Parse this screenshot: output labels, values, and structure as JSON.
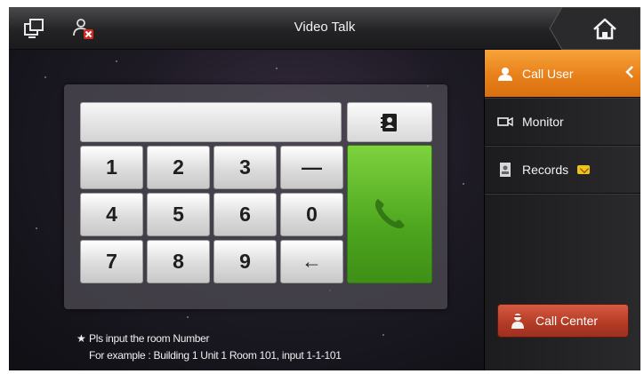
{
  "topbar": {
    "title": "Video Talk",
    "icons": [
      "windows-icon",
      "user-muted-icon",
      "home-icon"
    ]
  },
  "keypad": {
    "display_value": "",
    "contacts_icon": "contacts-book-icon",
    "keys": [
      "1",
      "2",
      "3",
      "—",
      "4",
      "5",
      "6",
      "0",
      "7",
      "8",
      "9",
      "←"
    ],
    "call_icon": "phone-icon"
  },
  "hint": {
    "bullet": "★",
    "line1": "Pls input the room Number",
    "line2": "For example : Building 1 Unit 1 Room 101, input 1-1-101"
  },
  "sidebar": {
    "items": [
      {
        "label": "Call User",
        "icon": "user-icon",
        "active": true
      },
      {
        "label": "Monitor",
        "icon": "camera-icon",
        "active": false
      },
      {
        "label": "Records",
        "icon": "records-icon",
        "active": false
      }
    ],
    "call_center_label": "Call Center"
  },
  "colors": {
    "accent_orange": "#e8801a",
    "call_green": "#4da61e",
    "call_center_red": "#b33a24"
  }
}
